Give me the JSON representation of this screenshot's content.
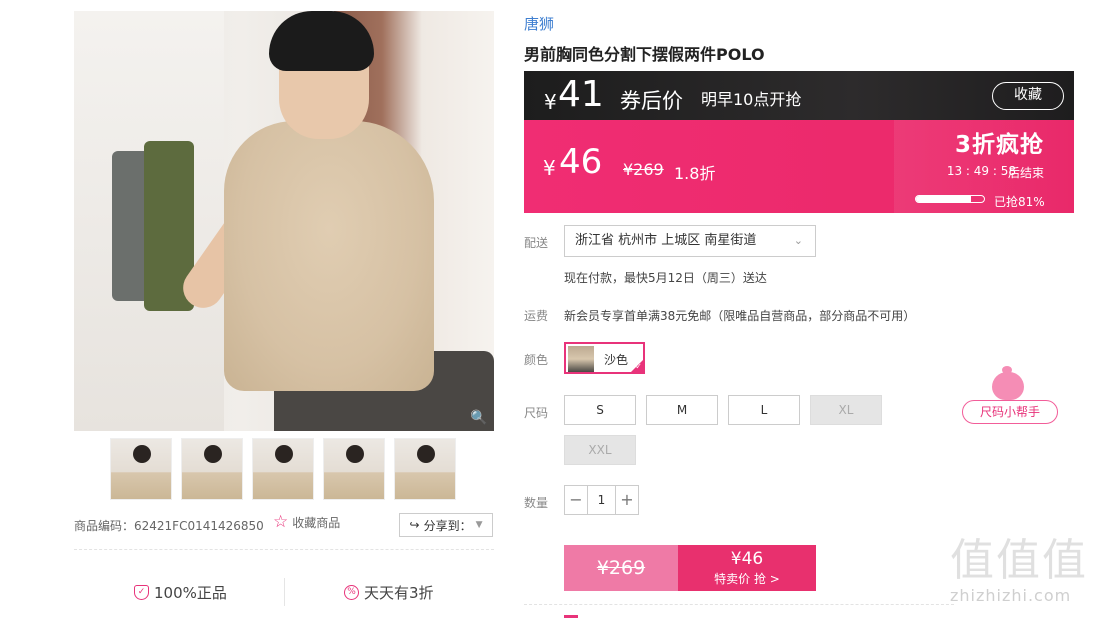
{
  "gallery": {
    "thumbnail_count": 5,
    "goods_code": "商品编码：62421FC0141426850",
    "favorite_label": "收藏商品",
    "share_label": "分享到："
  },
  "promises": [
    {
      "icon": "shield-check-icon",
      "label": "100%正品"
    },
    {
      "icon": "percent-icon",
      "label": "天天有3折"
    }
  ],
  "product": {
    "brand": "唐狮",
    "title": "男前胸同色分割下摆假两件POLO"
  },
  "coupon": {
    "yen": "¥",
    "price": "41",
    "label": "券后价",
    "start_time": "明早10点开抢",
    "collect_label": "收藏"
  },
  "sale": {
    "yen": "¥",
    "price": "46",
    "original": "¥269",
    "discount": "1.8折",
    "tag": "3折疯抢",
    "countdown": "13 : 49 : 58",
    "end_label": "后结束",
    "sold_label": "已抢81%",
    "sold_fraction": 0.81
  },
  "delivery": {
    "label": "配送",
    "address": "浙江省 杭州市 上城区 南星街道",
    "estimate": "现在付款，最快5月12日（周三）送达"
  },
  "shipping": {
    "label": "运费",
    "text": "新会员专享首单满38元免邮（限唯品自营商品，部分商品不可用）"
  },
  "color": {
    "label": "颜色",
    "selected": "沙色"
  },
  "size": {
    "label": "尺码",
    "options": [
      {
        "label": "S",
        "disabled": false
      },
      {
        "label": "M",
        "disabled": false
      },
      {
        "label": "L",
        "disabled": false
      },
      {
        "label": "XL",
        "disabled": true
      },
      {
        "label": "XXL",
        "disabled": true
      }
    ],
    "helper_label": "尺码小帮手"
  },
  "quantity": {
    "label": "数量",
    "value": "1",
    "minus": "−",
    "plus": "+"
  },
  "buy": {
    "original_price": "¥269",
    "sale_price": "¥46",
    "sale_label": "特卖价 抢 >"
  },
  "watermark": {
    "logo": "值值值",
    "url": "zhizhizhi.com"
  },
  "colors": {
    "accent": "#e8337a",
    "sale_bar": "#ec2a6c",
    "coupon_bar": "#222222",
    "brand_link": "#3f7fd0"
  }
}
